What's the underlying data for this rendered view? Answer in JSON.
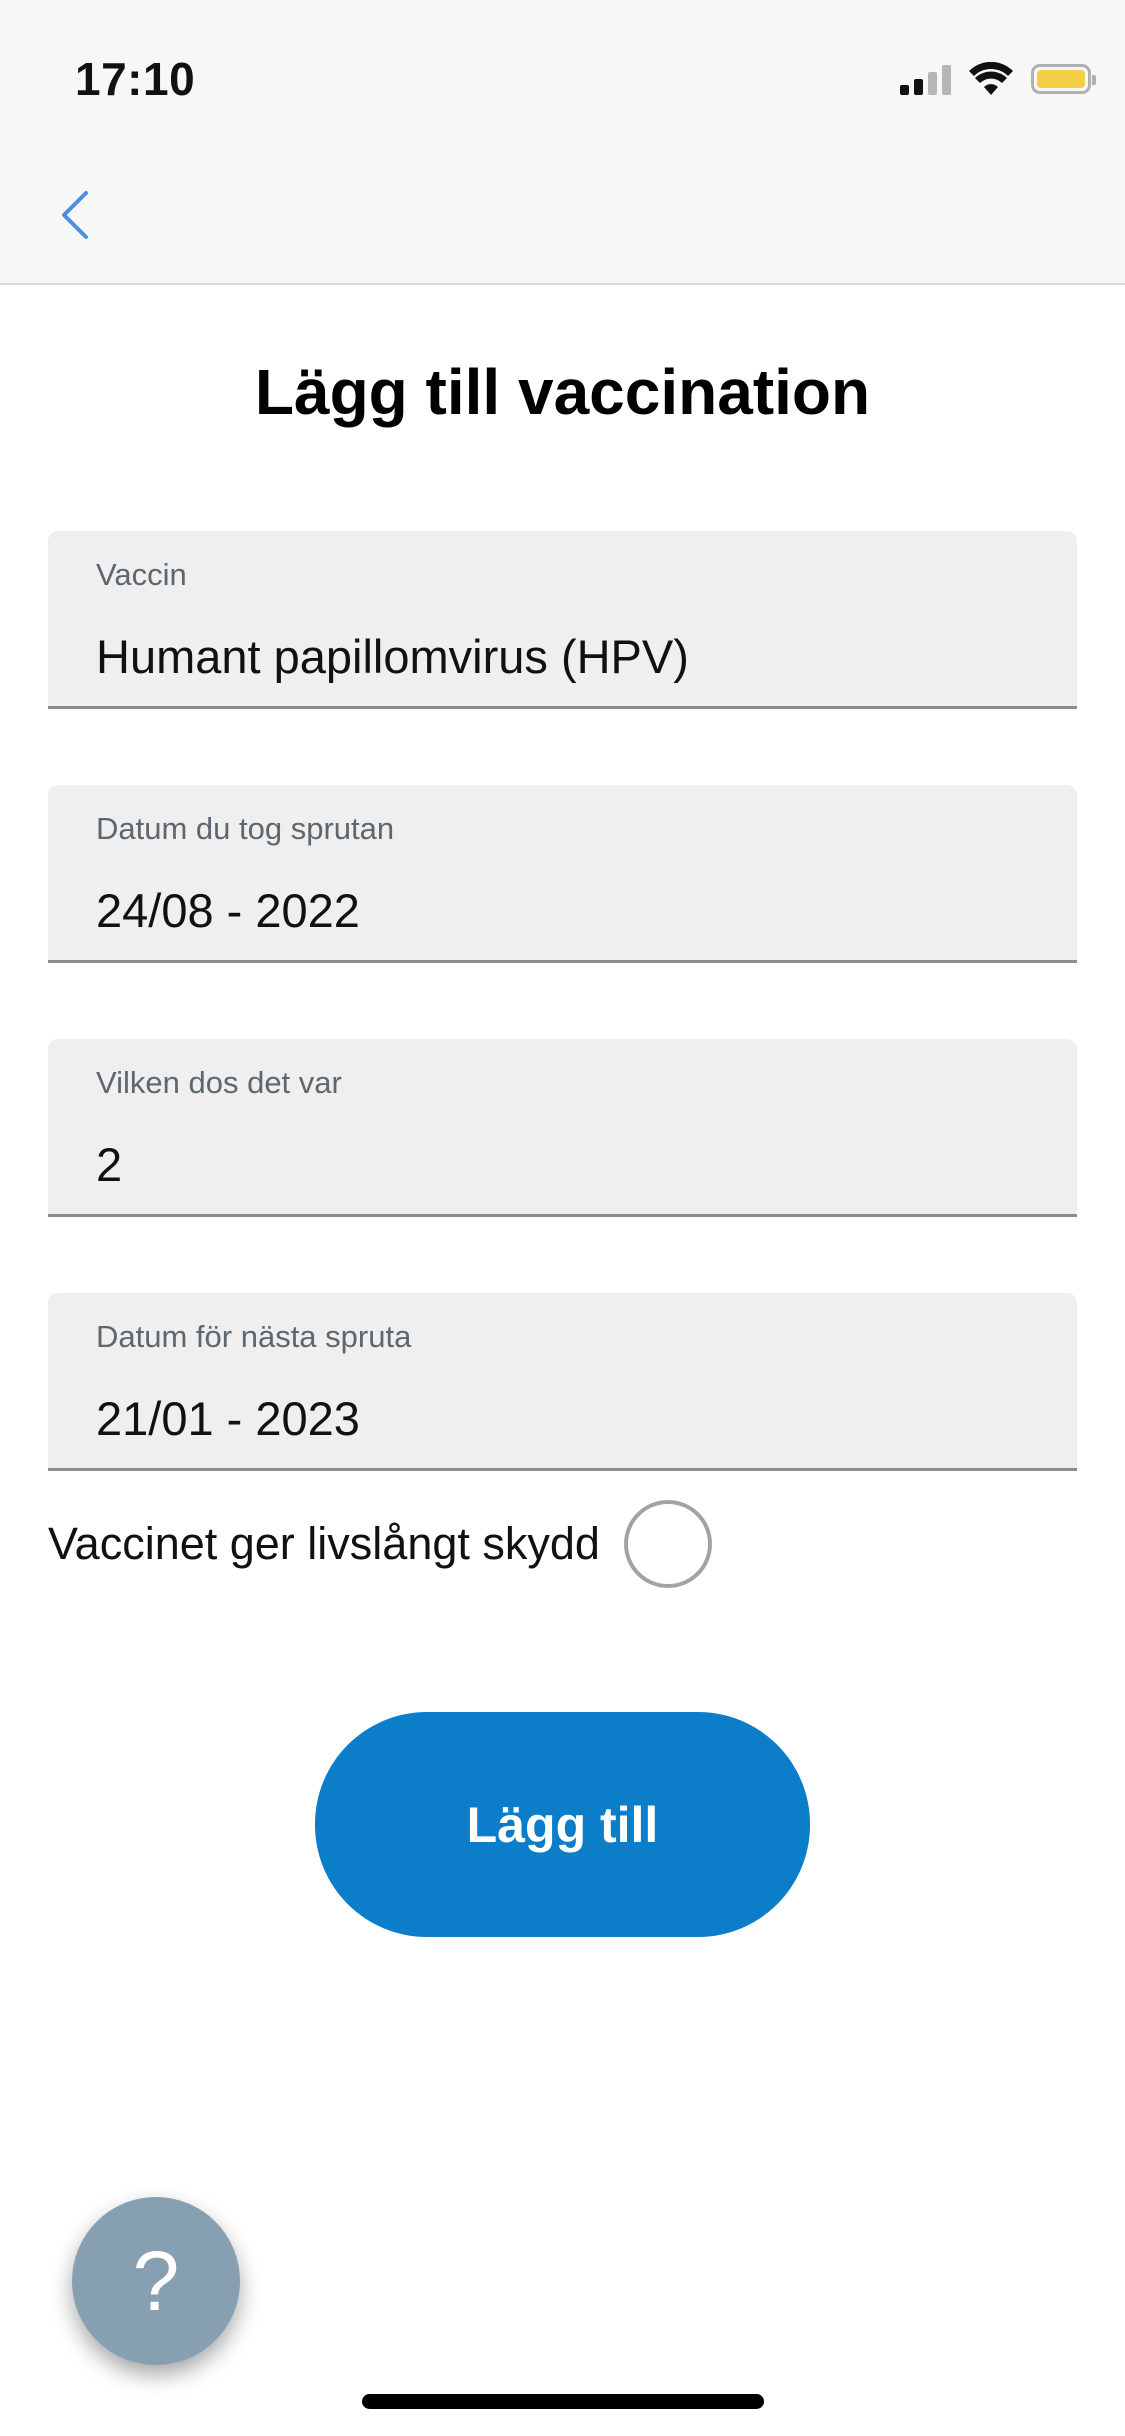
{
  "status_bar": {
    "time": "17:10",
    "icons": [
      "cellular-signal-icon",
      "wifi-icon",
      "battery-icon"
    ],
    "battery_color": "#f3cf48"
  },
  "nav": {
    "back_icon": "chevron-left-icon",
    "accent_color": "#4a90e2"
  },
  "page": {
    "title": "Lägg till vaccination"
  },
  "form": {
    "vaccine": {
      "label": "Vaccin",
      "value": "Humant papillomvirus (HPV)"
    },
    "date_taken": {
      "label": "Datum du tog sprutan",
      "value": "24/08 - 2022"
    },
    "dose": {
      "label": "Vilken dos det var",
      "value": "2"
    },
    "next_date": {
      "label": "Datum för nästa spruta",
      "value": "21/01 - 2023"
    },
    "lifelong": {
      "label": "Vaccinet ger livslångt skydd",
      "checked": false
    },
    "submit_label": "Lägg till",
    "submit_color": "#0b7dc9"
  },
  "help": {
    "icon": "question-mark-icon",
    "glyph": "?"
  }
}
